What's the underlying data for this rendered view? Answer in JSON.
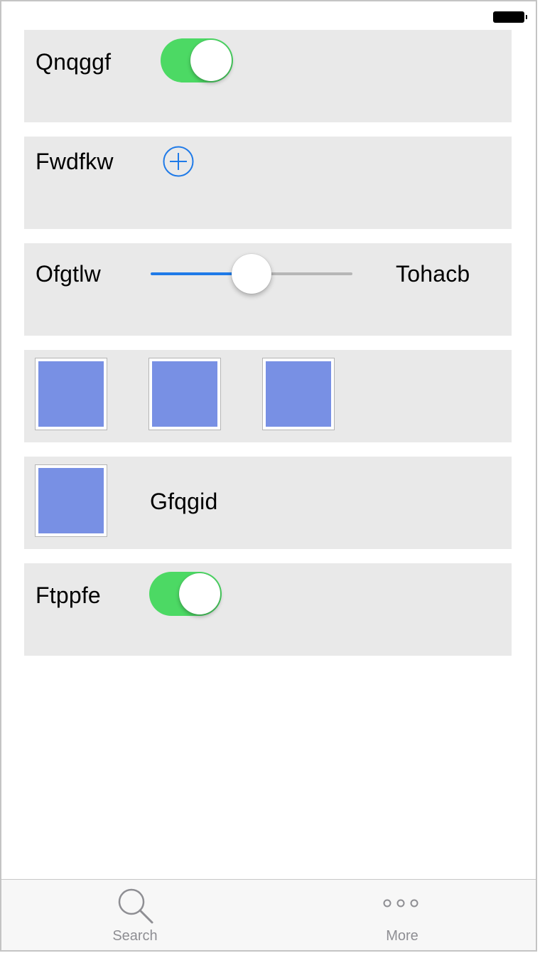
{
  "status_bar": {
    "battery_icon": "battery-icon"
  },
  "rows": {
    "toggle_row_1": {
      "label": "Qnqggf",
      "toggle_on": true
    },
    "add_row": {
      "label": "Fwdfkw",
      "icon": "plus-circle-icon"
    },
    "slider_row": {
      "label": "Ofgtlw",
      "trailing_label": "Tohacb",
      "slider_value": 0.5
    },
    "image_row": {
      "tiles": [
        "image-tile",
        "image-tile",
        "image-tile"
      ]
    },
    "image_label_row": {
      "label": "Gfqgid"
    },
    "toggle_row_2": {
      "label": "Ftppfe",
      "toggle_on": true
    }
  },
  "tab_bar": {
    "search": {
      "label": "Search",
      "icon": "search-icon"
    },
    "more": {
      "label": "More",
      "icon": "more-dots-icon"
    }
  },
  "colors": {
    "toggle_on": "#4cd964",
    "accent": "#1f7ae8",
    "cell_background": "#e9e9e9",
    "image_placeholder": "#7890e4",
    "tab_inactive": "#8e8e93"
  }
}
